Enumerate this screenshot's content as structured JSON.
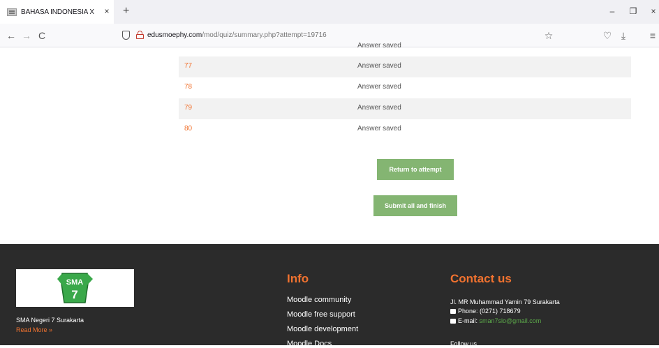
{
  "browser": {
    "tab_title": "BAHASA INDONESIA X",
    "tab_close": "×",
    "new_tab": "+",
    "url_host": "edusmoephy.com",
    "url_path": "/mod/quiz/summary.php?attempt=19716",
    "window_min": "–",
    "window_restore": "❐",
    "window_close": "×",
    "back_glyph": "←",
    "forward_glyph": "→",
    "reload_glyph": "C",
    "star_glyph": "☆",
    "pocket_glyph": "♡",
    "download_glyph": "⤓",
    "menu_glyph": "≡",
    "icons": [
      "back-icon",
      "forward-icon",
      "reload-icon",
      "shield-icon",
      "lock-icon",
      "bookmark-star-icon",
      "pocket-icon",
      "download-icon",
      "menu-icon"
    ]
  },
  "summary": {
    "cutoff_status": "Answer saved",
    "rows": [
      {
        "number": "77",
        "status": "Answer saved"
      },
      {
        "number": "78",
        "status": "Answer saved"
      },
      {
        "number": "79",
        "status": "Answer saved"
      },
      {
        "number": "80",
        "status": "Answer saved"
      }
    ],
    "return_button": "Return to attempt",
    "submit_button": "Submit all and finish"
  },
  "footer": {
    "logo_text": "SMA",
    "logo_number": "7",
    "school_name": "SMA Negeri 7 Surakarta",
    "read_more": "Read More »",
    "info_title": "Info",
    "info_links": [
      "Moodle community",
      "Moodle free support",
      "Moodle development",
      "Moodle Docs"
    ],
    "contact_title": "Contact us",
    "address": "Jl. MR Muhammad Yamin 79 Surakarta",
    "phone": "Phone: (0271) 718679",
    "email_label": "E-mail:",
    "email_value": "sman7slo@gmail.com",
    "follow_us": "Follow us"
  },
  "colors": {
    "accent": "#f1722f",
    "button": "#84b572",
    "footer_bg": "#2b2b2b",
    "email": "#5ca94a"
  }
}
